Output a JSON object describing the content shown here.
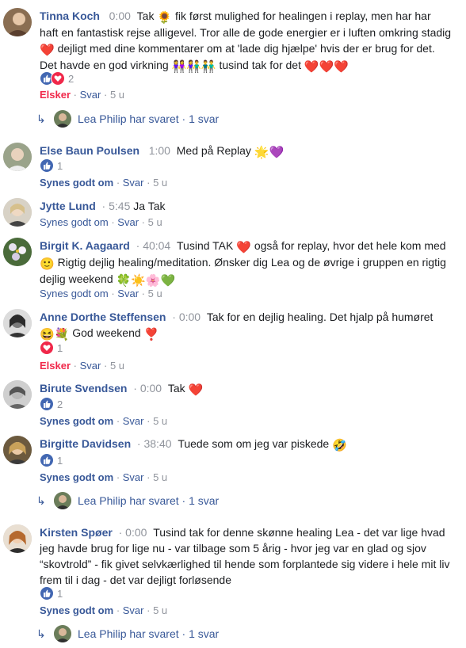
{
  "comments": [
    {
      "name": "Tinna Koch",
      "timestamp": "0:00",
      "text_parts": [
        "Tak",
        "🌻",
        "fik først mulighed for healingen i replay, men har har haft en fantastisk rejse alligevel. Tror alle de gode energier er i luften omkring stadig",
        "❤️",
        "dejligt med dine kommentarer om at 'lade dig hjælpe' hvis der er brug for det. Det havde en god virkning",
        "👭👫👬",
        "tusind tak for det",
        "❤️❤️❤️"
      ],
      "reaction_count": "2",
      "action_primary": "Elsker",
      "reply_label": "Svar",
      "age": "5 u",
      "reply_summary": "Lea Philip har svaret · 1 svar"
    },
    {
      "name": "Else Baun Poulsen",
      "timestamp": "1:00",
      "text_parts": [
        "Med på Replay",
        "🌟💜"
      ],
      "reaction_count": "1",
      "action_primary": "Synes godt om",
      "reply_label": "Svar",
      "age": "5 u"
    },
    {
      "name": "Jytte Lund",
      "timestamp": "5:45",
      "text_parts": [
        "Ja Tak"
      ],
      "action_primary": "Synes godt om",
      "reply_label": "Svar",
      "age": "5 u"
    },
    {
      "name": "Birgit K. Aagaard",
      "timestamp": "40:04",
      "text_parts": [
        "Tusind TAK",
        "❤️",
        "også for replay, hvor det hele kom med",
        "🙂",
        "Rigtig dejlig healing/meditation. Ønsker dig Lea og de øvrige i gruppen en rigtig dejlig weekend",
        "🍀☀️🌸💚"
      ],
      "action_primary": "Synes godt om",
      "reply_label": "Svar",
      "age": "5 u"
    },
    {
      "name": "Anne Dorthe Steffensen",
      "timestamp": "0:00",
      "text_parts": [
        "Tak for en dejlig healing. Det hjalp på humøret",
        "😆💐",
        "God weekend",
        "❣️"
      ],
      "reaction_count": "1",
      "action_primary": "Elsker",
      "reply_label": "Svar",
      "age": "5 u"
    },
    {
      "name": "Birute Svendsen",
      "timestamp": "0:00",
      "text_parts": [
        "Tak",
        "❤️"
      ],
      "reaction_count": "2",
      "action_primary": "Synes godt om",
      "reply_label": "Svar",
      "age": "5 u"
    },
    {
      "name": "Birgitte Davidsen",
      "timestamp": "38:40",
      "text_parts": [
        "Tuede som om jeg var piskede",
        "🤣"
      ],
      "reaction_count": "1",
      "action_primary": "Synes godt om",
      "reply_label": "Svar",
      "age": "5 u",
      "reply_summary": "Lea Philip har svaret · 1 svar"
    },
    {
      "name": "Kirsten Spøer",
      "timestamp": "0:00",
      "text_parts": [
        "Tusind tak for denne skønne healing Lea - det var lige hvad jeg havde brug for lige nu - var tilbage som 5 årig - hvor jeg var en glad og sjov “skovtrold” - fik givet selvkærlighed til hende som forplantede sig videre i hele mit liv frem til i dag - det var dejligt forløsende"
      ],
      "reaction_count": "1",
      "action_primary": "Synes godt om",
      "reply_label": "Svar",
      "age": "5 u",
      "reply_summary": "Lea Philip har svaret · 1 svar"
    }
  ],
  "colors": {
    "link": "#385898",
    "meta": "#90949c",
    "love": "#f0284a",
    "like": "#4267b2"
  },
  "separator": "·"
}
